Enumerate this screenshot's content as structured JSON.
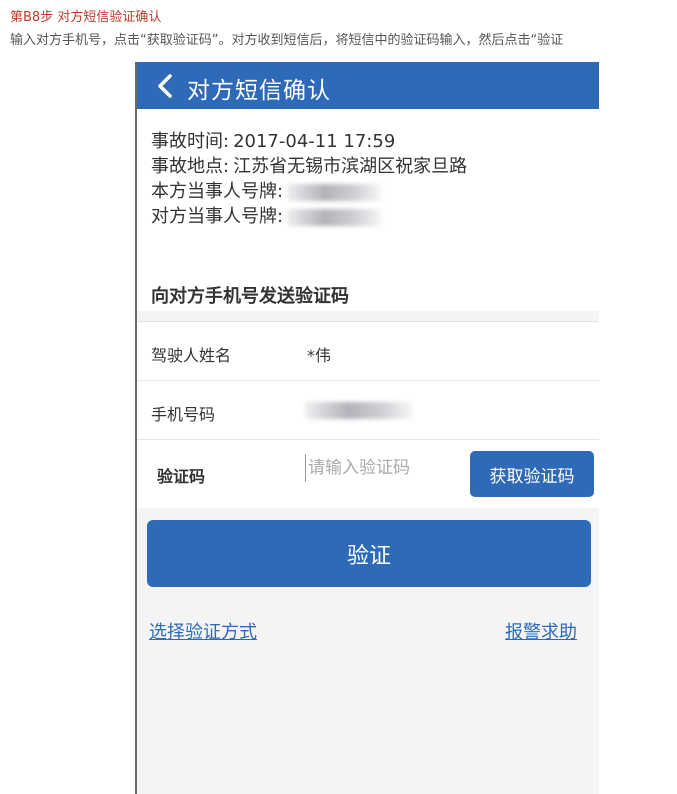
{
  "article": {
    "step_title": "第B8步 对方短信验证确认",
    "description": "输入对方手机号，点击“获取验证码”。对方收到短信后，将短信中的验证码输入，然后点击“验证"
  },
  "nav": {
    "back_icon": "chevron-left-icon",
    "title": "对方短信确认"
  },
  "accident_info": {
    "time_label": "事故时间:",
    "time_value": "2017-04-11 17:59",
    "place_label": "事故地点:",
    "place_value": "江苏省无锡市滨湖区祝家旦路",
    "own_plate_label": "本方当事人号牌:",
    "other_plate_label": "对方当事人号牌:"
  },
  "sms_section": {
    "title": "向对方手机号发送验证码",
    "driver_name_label": "驾驶人姓名",
    "driver_name_value": "*伟",
    "phone_label": "手机号码",
    "code_label": "验证码",
    "code_placeholder": "请输入验证码",
    "get_code_button": "获取验证码"
  },
  "verify_button": "验证",
  "links": {
    "choose_method": "选择验证方式",
    "report_police": "报警求助"
  },
  "colors": {
    "primary": "#2f6ab8",
    "article_title": "#c0392b"
  }
}
